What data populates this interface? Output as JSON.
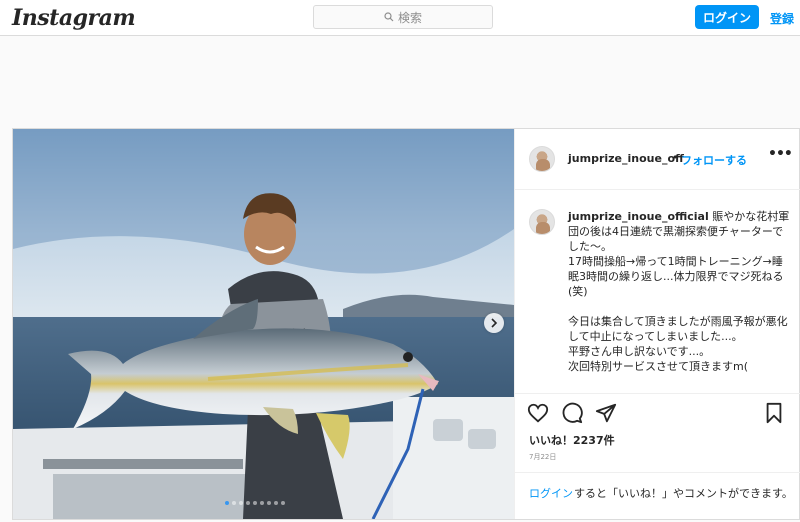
{
  "header": {
    "logo_text": "Instagram",
    "search_placeholder": "検索",
    "login_label": "ログイン",
    "signup_label": "登録"
  },
  "post": {
    "username": "jumprize_inoue_off",
    "dot": "•",
    "follow_label": "フォローする",
    "more_label": "•••",
    "caption_username": "jumprize_inoue_official",
    "caption_text": " 賑やかな花村軍団の後は4日連続で黒潮探索便チャーターでした〜。\n17時間操船→帰って1時間トレーニング→睡眠3時間の繰り返し...体力限界でマジ死ねる(笑)\n\n今日は集合して頂きましたが雨風予報が悪化して中止になってしまいました...。\n平野さん申し訳ないです...。\n次回特別サービスさせて頂きますm(",
    "likes": "いいね！2237件",
    "date": "7月22日",
    "login_link": "ログイン",
    "login_prompt_text": "すると「いいね！」やコメントができます。",
    "carousel_count": 9,
    "carousel_active_index": 0
  },
  "icons": {
    "search": "search-icon",
    "like": "heart-icon",
    "comment": "comment-icon",
    "share": "paper-plane-icon",
    "save": "bookmark-icon",
    "next": "chevron-right-icon"
  },
  "colors": {
    "accent": "#0095f6",
    "border": "#dbdbdb",
    "text": "#262626",
    "muted": "#8e8e8e"
  }
}
